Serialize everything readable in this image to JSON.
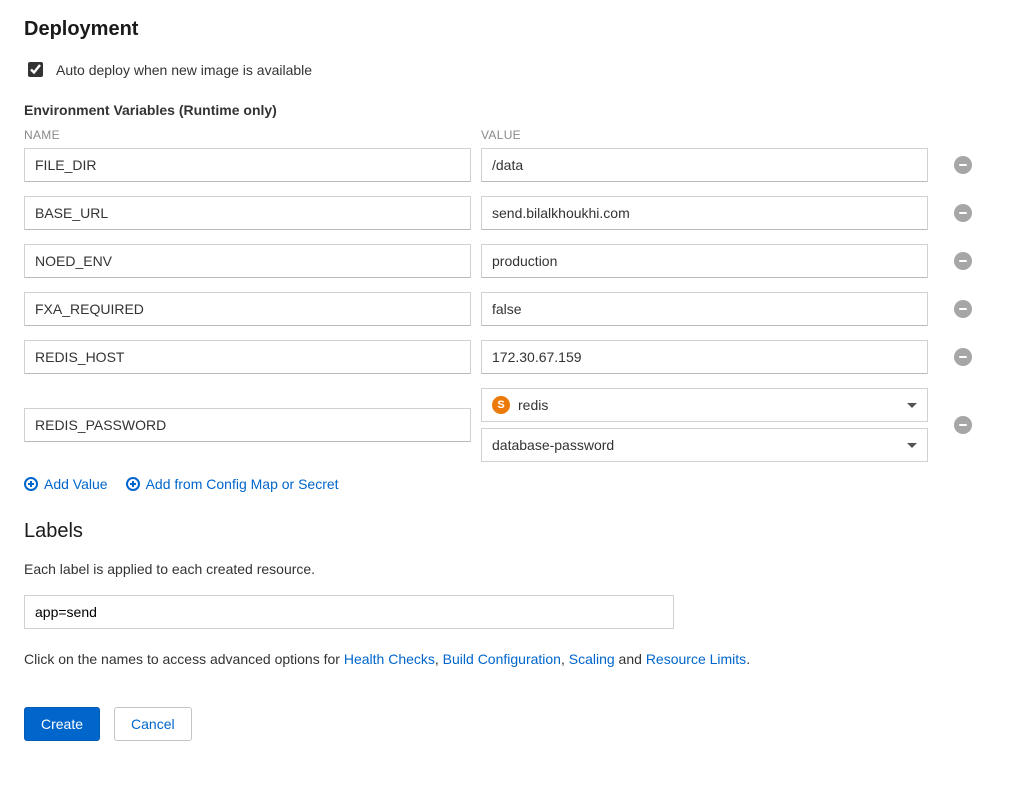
{
  "deployment": {
    "title": "Deployment",
    "auto_deploy_label": "Auto deploy when new image is available",
    "auto_deploy_checked": true
  },
  "env": {
    "header": "Environment Variables (Runtime only)",
    "col_name": "NAME",
    "col_value": "VALUE",
    "rows": [
      {
        "name": "FILE_DIR",
        "value": "/data"
      },
      {
        "name": "BASE_URL",
        "value": "send.bilalkhoukhi.com"
      },
      {
        "name": "NOED_ENV",
        "value": "production"
      },
      {
        "name": "FXA_REQUIRED",
        "value": "false"
      },
      {
        "name": "REDIS_HOST",
        "value": "172.30.67.159"
      }
    ],
    "secret_row": {
      "name": "REDIS_PASSWORD",
      "badge_letter": "S",
      "secret_source": "redis",
      "secret_key": "database-password"
    },
    "add_value": "Add Value",
    "add_from_config": "Add from Config Map or Secret"
  },
  "labels": {
    "title": "Labels",
    "description": "Each label is applied to each created resource.",
    "value": "app=send"
  },
  "advanced": {
    "prefix": "Click on the names to access advanced options for ",
    "links": {
      "health": "Health Checks",
      "build": "Build Configuration",
      "scaling": "Scaling",
      "limits": "Resource Limits"
    },
    "and": " and "
  },
  "buttons": {
    "create": "Create",
    "cancel": "Cancel"
  }
}
